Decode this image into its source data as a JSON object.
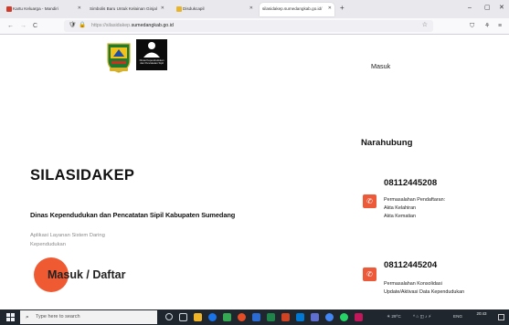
{
  "browser": {
    "tabs": [
      {
        "label": "Kartu Keluarga - Mandiri",
        "active": false
      },
      {
        "label": "Simbolis Baru Untuk Kelainan Ginjal",
        "active": false
      },
      {
        "label": "Disdukcapil",
        "active": false
      },
      {
        "label": "silasidakep.sumedangkab.go.id/",
        "active": true
      }
    ],
    "new_tab_glyph": "+",
    "window_controls": [
      "–",
      "▢",
      "✕"
    ],
    "nav": {
      "back": "←",
      "forward": "→",
      "reload": "C"
    },
    "url": {
      "prefix": "https://silasidakep.",
      "domain": "sumedangkab.go.id"
    },
    "toolbar_icons": [
      "star-icon",
      "shield-icon",
      "extensions-icon",
      "menu-icon"
    ]
  },
  "page": {
    "header": {
      "login_link": "Masuk",
      "logo_dukcapil_text": "Dinas Kependudukan dan Pencatatan Sipil"
    },
    "hero": {
      "title": "SILASIDAKEP",
      "subtitle": "Dinas Kependudukan dan Pencatatan Sipil Kabupaten Sumedang",
      "description": "Aplikasi Layanan Sistem Daring Kependudukan",
      "login_button": "Masuk / Daftar",
      "accent": "#f05a33"
    },
    "contact": {
      "heading": "Narahubung",
      "entries": [
        {
          "phone": "08112445208",
          "services": [
            "Permasalahan Pendaftaran:",
            "Akta Kelahiran",
            "Akta Kematian"
          ]
        },
        {
          "phone": "08112445204",
          "services": [
            "Permasalahan Konsolidasi",
            "Update/Aktivasi Data Kependudukan"
          ]
        }
      ],
      "icon_color": "#ec5a3a"
    }
  },
  "taskbar": {
    "search_placeholder": "Type here to search",
    "tray": {
      "weather": "29°C",
      "lang": "ENG"
    },
    "clock": {
      "time": "20:43",
      "date": ""
    }
  }
}
